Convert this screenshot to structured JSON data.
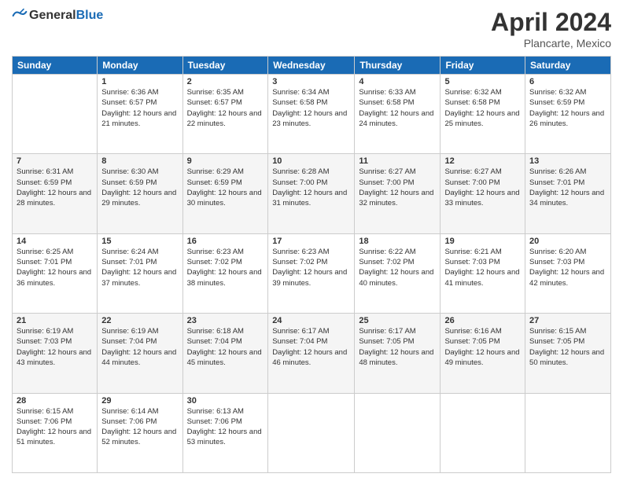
{
  "header": {
    "logo_general": "General",
    "logo_blue": "Blue",
    "title": "April 2024",
    "location": "Plancarte, Mexico"
  },
  "days_header": [
    "Sunday",
    "Monday",
    "Tuesday",
    "Wednesday",
    "Thursday",
    "Friday",
    "Saturday"
  ],
  "weeks": [
    {
      "days": [
        {
          "num": "",
          "sunrise": "",
          "sunset": "",
          "daylight": ""
        },
        {
          "num": "1",
          "sunrise": "Sunrise: 6:36 AM",
          "sunset": "Sunset: 6:57 PM",
          "daylight": "Daylight: 12 hours and 21 minutes."
        },
        {
          "num": "2",
          "sunrise": "Sunrise: 6:35 AM",
          "sunset": "Sunset: 6:57 PM",
          "daylight": "Daylight: 12 hours and 22 minutes."
        },
        {
          "num": "3",
          "sunrise": "Sunrise: 6:34 AM",
          "sunset": "Sunset: 6:58 PM",
          "daylight": "Daylight: 12 hours and 23 minutes."
        },
        {
          "num": "4",
          "sunrise": "Sunrise: 6:33 AM",
          "sunset": "Sunset: 6:58 PM",
          "daylight": "Daylight: 12 hours and 24 minutes."
        },
        {
          "num": "5",
          "sunrise": "Sunrise: 6:32 AM",
          "sunset": "Sunset: 6:58 PM",
          "daylight": "Daylight: 12 hours and 25 minutes."
        },
        {
          "num": "6",
          "sunrise": "Sunrise: 6:32 AM",
          "sunset": "Sunset: 6:59 PM",
          "daylight": "Daylight: 12 hours and 26 minutes."
        }
      ]
    },
    {
      "days": [
        {
          "num": "7",
          "sunrise": "Sunrise: 6:31 AM",
          "sunset": "Sunset: 6:59 PM",
          "daylight": "Daylight: 12 hours and 28 minutes."
        },
        {
          "num": "8",
          "sunrise": "Sunrise: 6:30 AM",
          "sunset": "Sunset: 6:59 PM",
          "daylight": "Daylight: 12 hours and 29 minutes."
        },
        {
          "num": "9",
          "sunrise": "Sunrise: 6:29 AM",
          "sunset": "Sunset: 6:59 PM",
          "daylight": "Daylight: 12 hours and 30 minutes."
        },
        {
          "num": "10",
          "sunrise": "Sunrise: 6:28 AM",
          "sunset": "Sunset: 7:00 PM",
          "daylight": "Daylight: 12 hours and 31 minutes."
        },
        {
          "num": "11",
          "sunrise": "Sunrise: 6:27 AM",
          "sunset": "Sunset: 7:00 PM",
          "daylight": "Daylight: 12 hours and 32 minutes."
        },
        {
          "num": "12",
          "sunrise": "Sunrise: 6:27 AM",
          "sunset": "Sunset: 7:00 PM",
          "daylight": "Daylight: 12 hours and 33 minutes."
        },
        {
          "num": "13",
          "sunrise": "Sunrise: 6:26 AM",
          "sunset": "Sunset: 7:01 PM",
          "daylight": "Daylight: 12 hours and 34 minutes."
        }
      ]
    },
    {
      "days": [
        {
          "num": "14",
          "sunrise": "Sunrise: 6:25 AM",
          "sunset": "Sunset: 7:01 PM",
          "daylight": "Daylight: 12 hours and 36 minutes."
        },
        {
          "num": "15",
          "sunrise": "Sunrise: 6:24 AM",
          "sunset": "Sunset: 7:01 PM",
          "daylight": "Daylight: 12 hours and 37 minutes."
        },
        {
          "num": "16",
          "sunrise": "Sunrise: 6:23 AM",
          "sunset": "Sunset: 7:02 PM",
          "daylight": "Daylight: 12 hours and 38 minutes."
        },
        {
          "num": "17",
          "sunrise": "Sunrise: 6:23 AM",
          "sunset": "Sunset: 7:02 PM",
          "daylight": "Daylight: 12 hours and 39 minutes."
        },
        {
          "num": "18",
          "sunrise": "Sunrise: 6:22 AM",
          "sunset": "Sunset: 7:02 PM",
          "daylight": "Daylight: 12 hours and 40 minutes."
        },
        {
          "num": "19",
          "sunrise": "Sunrise: 6:21 AM",
          "sunset": "Sunset: 7:03 PM",
          "daylight": "Daylight: 12 hours and 41 minutes."
        },
        {
          "num": "20",
          "sunrise": "Sunrise: 6:20 AM",
          "sunset": "Sunset: 7:03 PM",
          "daylight": "Daylight: 12 hours and 42 minutes."
        }
      ]
    },
    {
      "days": [
        {
          "num": "21",
          "sunrise": "Sunrise: 6:19 AM",
          "sunset": "Sunset: 7:03 PM",
          "daylight": "Daylight: 12 hours and 43 minutes."
        },
        {
          "num": "22",
          "sunrise": "Sunrise: 6:19 AM",
          "sunset": "Sunset: 7:04 PM",
          "daylight": "Daylight: 12 hours and 44 minutes."
        },
        {
          "num": "23",
          "sunrise": "Sunrise: 6:18 AM",
          "sunset": "Sunset: 7:04 PM",
          "daylight": "Daylight: 12 hours and 45 minutes."
        },
        {
          "num": "24",
          "sunrise": "Sunrise: 6:17 AM",
          "sunset": "Sunset: 7:04 PM",
          "daylight": "Daylight: 12 hours and 46 minutes."
        },
        {
          "num": "25",
          "sunrise": "Sunrise: 6:17 AM",
          "sunset": "Sunset: 7:05 PM",
          "daylight": "Daylight: 12 hours and 48 minutes."
        },
        {
          "num": "26",
          "sunrise": "Sunrise: 6:16 AM",
          "sunset": "Sunset: 7:05 PM",
          "daylight": "Daylight: 12 hours and 49 minutes."
        },
        {
          "num": "27",
          "sunrise": "Sunrise: 6:15 AM",
          "sunset": "Sunset: 7:05 PM",
          "daylight": "Daylight: 12 hours and 50 minutes."
        }
      ]
    },
    {
      "days": [
        {
          "num": "28",
          "sunrise": "Sunrise: 6:15 AM",
          "sunset": "Sunset: 7:06 PM",
          "daylight": "Daylight: 12 hours and 51 minutes."
        },
        {
          "num": "29",
          "sunrise": "Sunrise: 6:14 AM",
          "sunset": "Sunset: 7:06 PM",
          "daylight": "Daylight: 12 hours and 52 minutes."
        },
        {
          "num": "30",
          "sunrise": "Sunrise: 6:13 AM",
          "sunset": "Sunset: 7:06 PM",
          "daylight": "Daylight: 12 hours and 53 minutes."
        },
        {
          "num": "",
          "sunrise": "",
          "sunset": "",
          "daylight": ""
        },
        {
          "num": "",
          "sunrise": "",
          "sunset": "",
          "daylight": ""
        },
        {
          "num": "",
          "sunrise": "",
          "sunset": "",
          "daylight": ""
        },
        {
          "num": "",
          "sunrise": "",
          "sunset": "",
          "daylight": ""
        }
      ]
    }
  ]
}
